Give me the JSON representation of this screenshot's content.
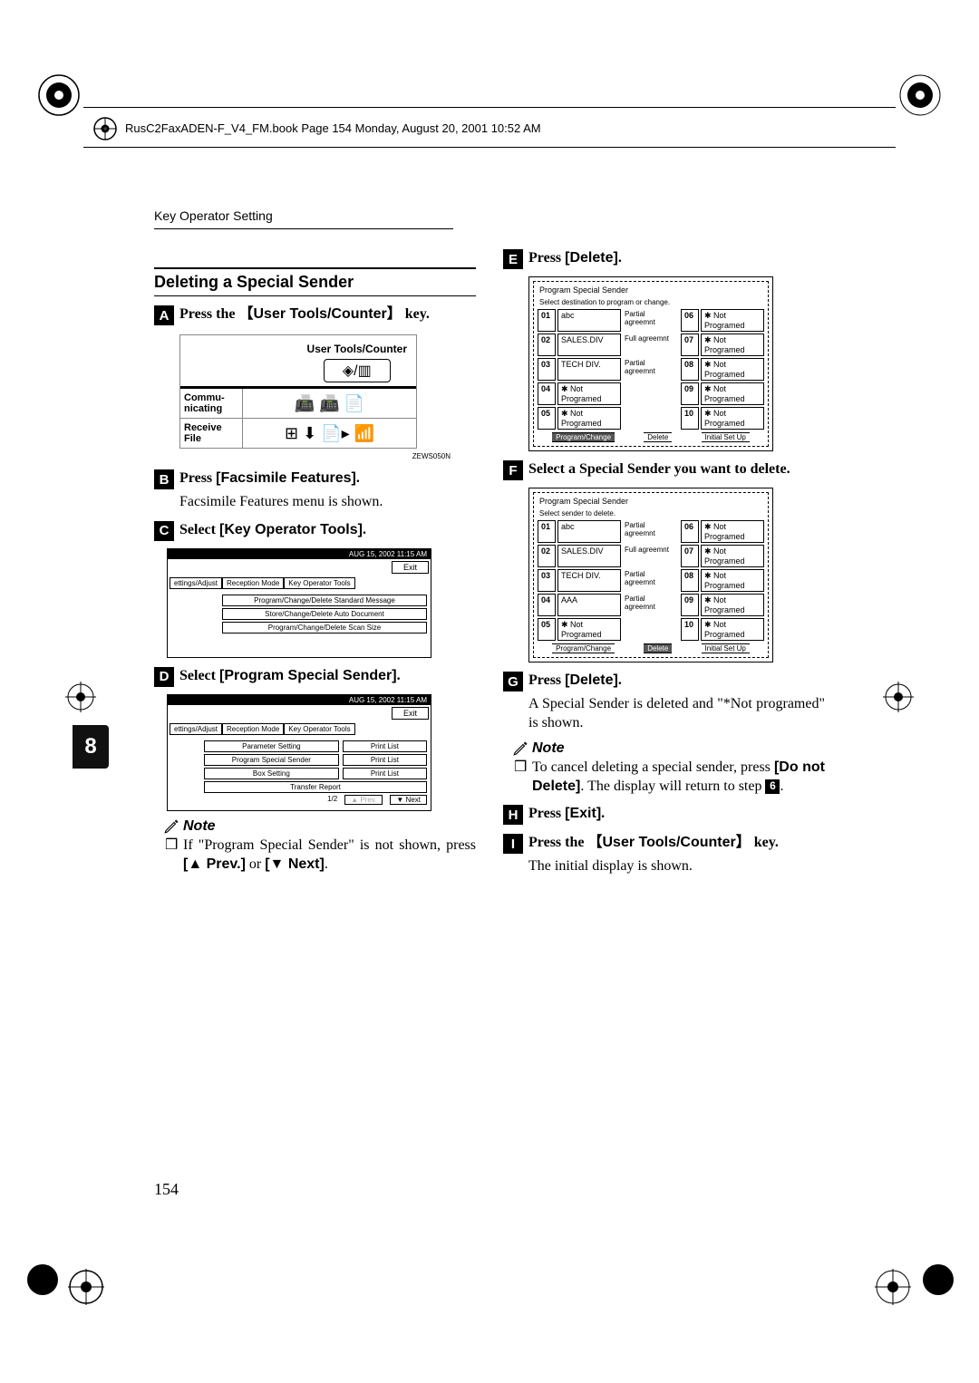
{
  "doc_header": {
    "file_info": "RusC2FaxADEN-F_V4_FM.book  Page 154  Monday, August 20, 2001  10:52 AM",
    "running_head": "Key Operator Setting"
  },
  "page_number": "154",
  "side_tab": "8",
  "left_col": {
    "heading": "Deleting a Special Sender",
    "step1_prefix": "Press the ",
    "step1_key": "User Tools/Counter",
    "step1_suffix": " key.",
    "hw_panel": {
      "title": "User Tools/Counter",
      "row1_label": "Commu-\nnicating",
      "row2_label": "Receive\nFile",
      "code": "ZEWS050N"
    },
    "step2_prefix": "Press ",
    "step2_key": "[Facsimile Features]",
    "step2_suffix": ".",
    "step2_body": "Facsimile Features menu is shown.",
    "step3_prefix": "Select ",
    "step3_key": "[Key Operator Tools]",
    "step3_suffix": ".",
    "menu3": {
      "date": "AUG 15, 2002  11:15 AM",
      "exit": "Exit",
      "tabs": [
        "ettings/Adjust",
        "Reception Mode",
        "Key Operator Tools"
      ],
      "items": [
        "Program/Change/Delete Standard Message",
        "Store/Change/Delete Auto Document",
        "Program/Change/Delete Scan Size"
      ]
    },
    "step4_prefix": "Select ",
    "step4_key": "[Program Special Sender]",
    "step4_suffix": ".",
    "menu4": {
      "date": "AUG 15, 2002  11:15 AM",
      "exit": "Exit",
      "tabs": [
        "ettings/Adjust",
        "Reception Mode",
        "Key Operator Tools"
      ],
      "rows": [
        {
          "l": "Parameter Setting",
          "r": "Print List"
        },
        {
          "l": "Program Special Sender",
          "r": "Print List"
        },
        {
          "l": "Box Setting",
          "r": "Print List"
        },
        {
          "l": "Transfer Report",
          "r": ""
        }
      ],
      "footer": {
        "page": "1/2",
        "prev": "▲ Prev.",
        "next": "▼ Next"
      }
    },
    "note_label": "Note",
    "note1_text_a": "If \"Program Special Sender\" is not shown, press ",
    "note1_key1": "[▲ Prev.]",
    "note1_or": " or ",
    "note1_key2": "[▼ Next]",
    "note1_text_b": "."
  },
  "right_col": {
    "step5_prefix": "Press ",
    "step5_key": "[Delete]",
    "step5_suffix": ".",
    "screen5": {
      "title": "Program Special Sender",
      "subtitle": "Select destination to program or change.",
      "rows": [
        {
          "n": "01",
          "name": "abc",
          "agree": "Partial agreemnt",
          "n2": "06",
          "name2": "✱ Not Programed"
        },
        {
          "n": "02",
          "name": "SALES.DIV",
          "agree": "Full agreemnt",
          "n2": "07",
          "name2": "✱ Not Programed"
        },
        {
          "n": "03",
          "name": "TECH DIV.",
          "agree": "Partial agreemnt",
          "n2": "08",
          "name2": "✱ Not Programed"
        },
        {
          "n": "04",
          "name": "✱ Not Programed",
          "agree": "",
          "n2": "09",
          "name2": "✱ Not Programed"
        },
        {
          "n": "05",
          "name": "✱ Not Programed",
          "agree": "",
          "n2": "10",
          "name2": "✱ Not Programed"
        }
      ],
      "footer": {
        "btn1": "Program/Change",
        "btn2": "Delete",
        "btn3": "Initial Set Up"
      }
    },
    "step6_text": "Select a Special Sender you want to delete.",
    "screen6": {
      "title": "Program Special Sender",
      "subtitle": "Select sender to delete.",
      "rows": [
        {
          "n": "01",
          "name": "abc",
          "agree": "Partial agreemnt",
          "n2": "06",
          "name2": "✱ Not Programed"
        },
        {
          "n": "02",
          "name": "SALES.DIV",
          "agree": "Full agreemnt",
          "n2": "07",
          "name2": "✱ Not Programed"
        },
        {
          "n": "03",
          "name": "TECH DIV.",
          "agree": "Partial agreemnt",
          "n2": "08",
          "name2": "✱ Not Programed"
        },
        {
          "n": "04",
          "name": "AAA",
          "agree": "Partial agreemnt",
          "n2": "09",
          "name2": "✱ Not Programed"
        },
        {
          "n": "05",
          "name": "✱ Not Programed",
          "agree": "",
          "n2": "10",
          "name2": "✱ Not Programed"
        }
      ],
      "footer": {
        "btn1": "Program/Change",
        "btn2": "Delete",
        "btn3": "Initial Set Up"
      }
    },
    "step7_prefix": "Press ",
    "step7_key": "[Delete]",
    "step7_suffix": ".",
    "step7_body": "A Special Sender is deleted and \"*Not programed\" is shown.",
    "note_label": "Note",
    "note7_text_a": "To cancel deleting a special sender, press ",
    "note7_key": "[Do not Delete]",
    "note7_text_b": ". The display will return to step ",
    "note7_badge": "6",
    "note7_text_c": ".",
    "step8_prefix": "Press ",
    "step8_key": "[Exit]",
    "step8_suffix": ".",
    "step9_prefix": "Press the ",
    "step9_key": "User Tools/Counter",
    "step9_suffix": " key.",
    "step9_body": "The initial display is shown."
  }
}
